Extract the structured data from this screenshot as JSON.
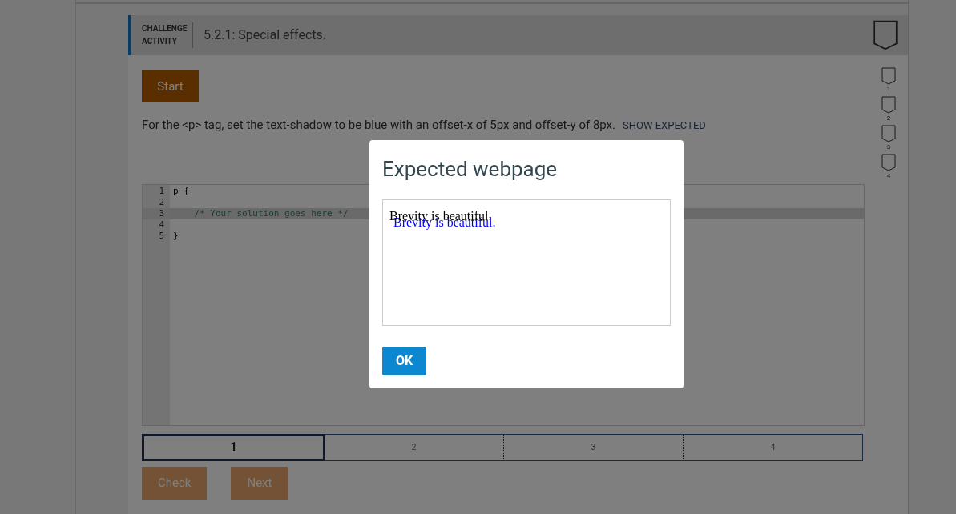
{
  "activity": {
    "label": "CHALLENGE ACTIVITY",
    "title": "5.2.1: Special effects."
  },
  "start_button": "Start",
  "instructions": "For the <p> tag, set the text-shadow to be blue with an offset-x of 5px and offset-y of 8px.",
  "show_expected": "SHOW EXPECTED",
  "code_lines": [
    {
      "number": "1",
      "text": "p {",
      "active": false,
      "kind": "code"
    },
    {
      "number": "2",
      "active": false,
      "kind": "code"
    },
    {
      "number": "3",
      "text": "    /* Your solution goes here */",
      "active": true,
      "kind": "comment"
    },
    {
      "number": "4",
      "active": false,
      "kind": "code"
    },
    {
      "number": "5",
      "text": "}",
      "active": false,
      "kind": "code"
    }
  ],
  "steps": [
    {
      "label": "1",
      "selected": true
    },
    {
      "label": "2",
      "selected": false
    },
    {
      "label": "3",
      "selected": false
    },
    {
      "label": "4",
      "selected": false
    }
  ],
  "level_badges": [
    "1",
    "2",
    "3",
    "4"
  ],
  "buttons": [
    "Check",
    "Next"
  ],
  "dialog": {
    "title": "Expected webpage",
    "preview_text": "Brevity is beautiful.",
    "ok_button": "OK"
  }
}
